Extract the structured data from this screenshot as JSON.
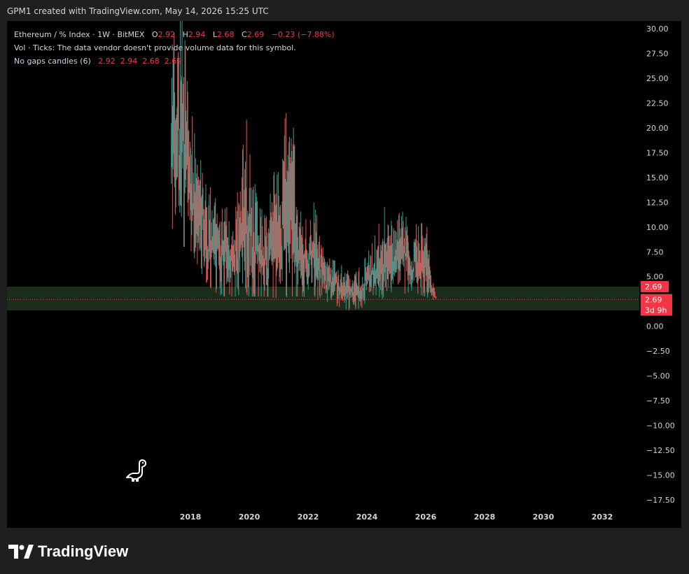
{
  "header": {
    "credit": "GPM1 created with TradingView.com, May 14, 2026 15:25 UTC"
  },
  "legend": {
    "symbol_line": "Ethereum / % Index · 1W · BitMEX",
    "o_key": "O",
    "o_val": "2.92",
    "h_key": "H",
    "h_val": "2.94",
    "l_key": "L",
    "l_val": "2.68",
    "c_key": "C",
    "c_val": "2.69",
    "change": "−0.23 (−7.88%)",
    "vol_line": "Vol · Ticks: The data vendor doesn't provide volume data for this symbol.",
    "gaps_label": "No gaps candles (6)",
    "gaps_values": "2.92  2.94  2.68  2.69"
  },
  "price_tags": {
    "upper": "2.69",
    "lower": "2.69",
    "countdown": "3d 9h"
  },
  "brand": {
    "name": "TradingView"
  },
  "colors": {
    "panel_bg": "#000000",
    "page_bg": "#1f1f1f",
    "up": "#26a69a",
    "down": "#ef5350",
    "zone": "#1b2e1b",
    "tag": "#f23645"
  },
  "icons": {
    "dino": "dino-icon",
    "logo": "tradingview-logo-icon"
  },
  "chart_data": {
    "type": "candlestick",
    "interval": "1W",
    "last_close": 2.69,
    "y_ticks": [
      30,
      27.5,
      25,
      22.5,
      20,
      17.5,
      15,
      12.5,
      10,
      7.5,
      5,
      2.5,
      0,
      -2.5,
      -5,
      -7.5,
      -10,
      -12.5,
      -15,
      -17.5
    ],
    "y_tick_labels": [
      "30.00",
      "27.50",
      "25.00",
      "22.50",
      "20.00",
      "17.50",
      "15.00",
      "12.50",
      "10.00",
      "7.50",
      "5.00",
      "",
      "0.00",
      "−2.50",
      "−5.00",
      "−7.50",
      "−10.00",
      "−12.50",
      "−15.00",
      "−17.50"
    ],
    "x_ticks": [
      2018,
      2020,
      2022,
      2024,
      2026,
      2028,
      2030,
      2032
    ],
    "x_tick_labels": [
      "2018",
      "2020",
      "2022",
      "2024",
      "2026",
      "2028",
      "2030",
      "2032"
    ],
    "x_range": [
      2016.0,
      2033.0
    ],
    "y_range": [
      -19.0,
      31.0
    ],
    "zone": [
      1.6,
      4.0
    ],
    "envelope": [
      {
        "t": 2017.35,
        "lo": 10.0,
        "hi": 31.0
      },
      {
        "t": 2017.55,
        "lo": 9.0,
        "hi": 31.0
      },
      {
        "t": 2017.75,
        "lo": 8.0,
        "hi": 31.0
      },
      {
        "t": 2017.95,
        "lo": 8.0,
        "hi": 24.0
      },
      {
        "t": 2018.2,
        "lo": 6.5,
        "hi": 18.0
      },
      {
        "t": 2018.5,
        "lo": 4.5,
        "hi": 15.5
      },
      {
        "t": 2018.8,
        "lo": 3.5,
        "hi": 13.0
      },
      {
        "t": 2019.1,
        "lo": 3.0,
        "hi": 12.5
      },
      {
        "t": 2019.5,
        "lo": 3.0,
        "hi": 11.0
      },
      {
        "t": 2019.9,
        "lo": 3.0,
        "hi": 21.0
      },
      {
        "t": 2020.3,
        "lo": 3.0,
        "hi": 12.0
      },
      {
        "t": 2020.6,
        "lo": 3.0,
        "hi": 11.5
      },
      {
        "t": 2021.0,
        "lo": 2.8,
        "hi": 18.0
      },
      {
        "t": 2021.4,
        "lo": 3.0,
        "hi": 23.5
      },
      {
        "t": 2021.8,
        "lo": 3.0,
        "hi": 10.0
      },
      {
        "t": 2022.2,
        "lo": 2.8,
        "hi": 12.5
      },
      {
        "t": 2022.6,
        "lo": 2.5,
        "hi": 7.0
      },
      {
        "t": 2023.0,
        "lo": 2.0,
        "hi": 6.5
      },
      {
        "t": 2023.4,
        "lo": 1.6,
        "hi": 5.5
      },
      {
        "t": 2023.8,
        "lo": 1.8,
        "hi": 6.0
      },
      {
        "t": 2024.2,
        "lo": 2.5,
        "hi": 8.5
      },
      {
        "t": 2024.6,
        "lo": 2.8,
        "hi": 12.0
      },
      {
        "t": 2025.0,
        "lo": 3.0,
        "hi": 10.5
      },
      {
        "t": 2025.2,
        "lo": 3.2,
        "hi": 15.0
      },
      {
        "t": 2025.5,
        "lo": 3.5,
        "hi": 10.0
      },
      {
        "t": 2025.8,
        "lo": 3.2,
        "hi": 10.5
      },
      {
        "t": 2026.05,
        "lo": 2.9,
        "hi": 10.0
      },
      {
        "t": 2026.2,
        "lo": 2.7,
        "hi": 5.0
      },
      {
        "t": 2026.35,
        "lo": 2.68,
        "hi": 3.2
      }
    ]
  }
}
